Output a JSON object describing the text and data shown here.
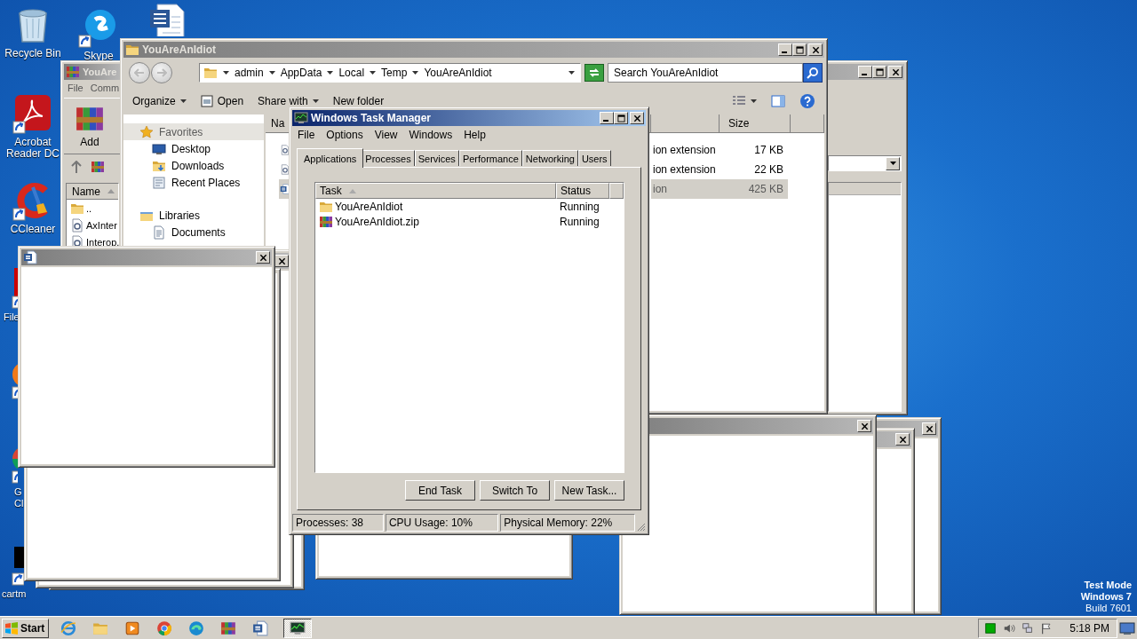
{
  "desktop_icons": [
    {
      "kind": "recycle",
      "label_lines": [
        "Recycle Bin"
      ]
    },
    {
      "kind": "skype",
      "label_lines": [
        "Skype"
      ]
    },
    {
      "kind": "word"
    },
    {
      "kind": "acrobat",
      "label_lines": [
        "Acrobat",
        "Reader DC"
      ]
    },
    {
      "kind": "ccleaner",
      "label_lines": [
        "CCleaner"
      ]
    },
    {
      "kind": "redfile",
      "label_lines": [
        "File"
      ]
    },
    {
      "kind": "firefox"
    },
    {
      "kind": "chrome",
      "label_lines": [
        "G",
        "Cl"
      ]
    },
    {
      "kind": "blackapp",
      "label_lines": [
        "cartm"
      ]
    }
  ],
  "winrar": {
    "title": "YouAre",
    "menu": [
      "File",
      "Comm"
    ],
    "add_label": "Add",
    "column": "Name",
    "rows": [
      {
        "kind": "folder",
        "name": ".."
      },
      {
        "kind": "dll",
        "name": "AxInter"
      },
      {
        "kind": "dll",
        "name": "Interop."
      }
    ]
  },
  "explorer": {
    "title": "YouAreAnIdiot",
    "breadcrumb": [
      "admin",
      "AppData",
      "Local",
      "Temp",
      "YouAreAnIdiot"
    ],
    "search_placeholder": "Search YouAreAnIdiot",
    "toolbar": [
      {
        "kind": "menu",
        "label": "Organize"
      },
      {
        "kind": "open",
        "label": "Open"
      },
      {
        "kind": "menu",
        "label": "Share with"
      },
      {
        "kind": "plain",
        "label": "New folder"
      }
    ],
    "nav": [
      {
        "kind": "star",
        "label": "Favorites",
        "selected": true,
        "children": [
          {
            "kind": "desktop",
            "label": "Desktop",
            "selected": false
          },
          {
            "kind": "downloads",
            "label": "Downloads",
            "selected": false
          },
          {
            "kind": "recent",
            "label": "Recent Places",
            "selected": false
          }
        ]
      },
      {
        "kind": "libraries",
        "label": "Libraries",
        "selected": false,
        "children": [
          {
            "kind": "documents",
            "label": "Documents",
            "selected": false
          }
        ]
      }
    ],
    "columns": [
      "Na",
      "Size"
    ],
    "files": [
      {
        "kind": "dll",
        "type": "ion extension",
        "size": "17 KB",
        "selected": false
      },
      {
        "kind": "dll",
        "type": "ion extension",
        "size": "22 KB",
        "selected": false
      },
      {
        "kind": "word",
        "type": "ion",
        "size": "425 KB",
        "selected": true
      }
    ]
  },
  "blank_windows": [
    {
      "kind": "plain"
    },
    {
      "kind": "plain"
    },
    {
      "kind": "plain"
    },
    {
      "kind": "untitled"
    },
    {
      "kind": "untitled"
    },
    {
      "kind": "plain"
    },
    {
      "kind": "untitled"
    },
    {
      "kind": "word"
    }
  ],
  "task_manager": {
    "title": "Windows Task Manager",
    "menu": [
      "File",
      "Options",
      "View",
      "Windows",
      "Help"
    ],
    "tabs": [
      {
        "label": "Applications",
        "selected": true
      },
      {
        "label": "Processes",
        "selected": false
      },
      {
        "label": "Services",
        "selected": false
      },
      {
        "label": "Performance",
        "selected": false
      },
      {
        "label": "Networking",
        "selected": false
      },
      {
        "label": "Users",
        "selected": false
      }
    ],
    "columns": [
      "Task",
      "Status"
    ],
    "tasks": [
      {
        "kind": "folder",
        "name": "YouAreAnIdiot",
        "status": "Running"
      },
      {
        "kind": "archive",
        "name": "YouAreAnIdiot.zip",
        "status": "Running"
      }
    ],
    "buttons": [
      "End Task",
      "Switch To",
      "New Task..."
    ],
    "status": [
      "Processes: 38",
      "CPU Usage: 10%",
      "Physical Memory: 22%"
    ]
  },
  "taskbar": {
    "start": "Start",
    "apps": [
      {
        "kind": "ie",
        "selected": false
      },
      {
        "kind": "folder",
        "selected": false
      },
      {
        "kind": "media",
        "selected": false
      },
      {
        "kind": "chrome",
        "selected": false
      },
      {
        "kind": "edge",
        "selected": false
      },
      {
        "kind": "archive",
        "selected": false
      },
      {
        "kind": "word",
        "selected": false
      },
      {
        "kind": "taskmgr",
        "selected": true
      }
    ],
    "tray": [
      {
        "kind": "green"
      },
      {
        "kind": "speaker"
      },
      {
        "kind": "network"
      },
      {
        "kind": "flag"
      }
    ],
    "clock": "5:18 PM"
  },
  "os_notice": [
    "Test Mode",
    "Windows 7",
    "Build 7601"
  ]
}
